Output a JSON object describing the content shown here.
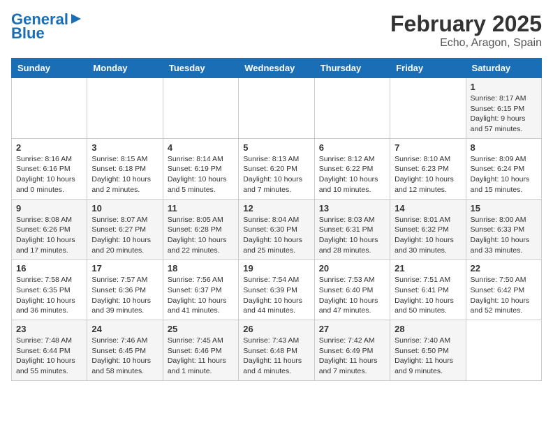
{
  "header": {
    "logo_line1": "General",
    "logo_line2": "Blue",
    "title": "February 2025",
    "subtitle": "Echo, Aragon, Spain"
  },
  "calendar": {
    "headers": [
      "Sunday",
      "Monday",
      "Tuesday",
      "Wednesday",
      "Thursday",
      "Friday",
      "Saturday"
    ],
    "weeks": [
      [
        {
          "day": "",
          "content": ""
        },
        {
          "day": "",
          "content": ""
        },
        {
          "day": "",
          "content": ""
        },
        {
          "day": "",
          "content": ""
        },
        {
          "day": "",
          "content": ""
        },
        {
          "day": "",
          "content": ""
        },
        {
          "day": "1",
          "content": "Sunrise: 8:17 AM\nSunset: 6:15 PM\nDaylight: 9 hours and 57 minutes."
        }
      ],
      [
        {
          "day": "2",
          "content": "Sunrise: 8:16 AM\nSunset: 6:16 PM\nDaylight: 10 hours and 0 minutes."
        },
        {
          "day": "3",
          "content": "Sunrise: 8:15 AM\nSunset: 6:18 PM\nDaylight: 10 hours and 2 minutes."
        },
        {
          "day": "4",
          "content": "Sunrise: 8:14 AM\nSunset: 6:19 PM\nDaylight: 10 hours and 5 minutes."
        },
        {
          "day": "5",
          "content": "Sunrise: 8:13 AM\nSunset: 6:20 PM\nDaylight: 10 hours and 7 minutes."
        },
        {
          "day": "6",
          "content": "Sunrise: 8:12 AM\nSunset: 6:22 PM\nDaylight: 10 hours and 10 minutes."
        },
        {
          "day": "7",
          "content": "Sunrise: 8:10 AM\nSunset: 6:23 PM\nDaylight: 10 hours and 12 minutes."
        },
        {
          "day": "8",
          "content": "Sunrise: 8:09 AM\nSunset: 6:24 PM\nDaylight: 10 hours and 15 minutes."
        }
      ],
      [
        {
          "day": "9",
          "content": "Sunrise: 8:08 AM\nSunset: 6:26 PM\nDaylight: 10 hours and 17 minutes."
        },
        {
          "day": "10",
          "content": "Sunrise: 8:07 AM\nSunset: 6:27 PM\nDaylight: 10 hours and 20 minutes."
        },
        {
          "day": "11",
          "content": "Sunrise: 8:05 AM\nSunset: 6:28 PM\nDaylight: 10 hours and 22 minutes."
        },
        {
          "day": "12",
          "content": "Sunrise: 8:04 AM\nSunset: 6:30 PM\nDaylight: 10 hours and 25 minutes."
        },
        {
          "day": "13",
          "content": "Sunrise: 8:03 AM\nSunset: 6:31 PM\nDaylight: 10 hours and 28 minutes."
        },
        {
          "day": "14",
          "content": "Sunrise: 8:01 AM\nSunset: 6:32 PM\nDaylight: 10 hours and 30 minutes."
        },
        {
          "day": "15",
          "content": "Sunrise: 8:00 AM\nSunset: 6:33 PM\nDaylight: 10 hours and 33 minutes."
        }
      ],
      [
        {
          "day": "16",
          "content": "Sunrise: 7:58 AM\nSunset: 6:35 PM\nDaylight: 10 hours and 36 minutes."
        },
        {
          "day": "17",
          "content": "Sunrise: 7:57 AM\nSunset: 6:36 PM\nDaylight: 10 hours and 39 minutes."
        },
        {
          "day": "18",
          "content": "Sunrise: 7:56 AM\nSunset: 6:37 PM\nDaylight: 10 hours and 41 minutes."
        },
        {
          "day": "19",
          "content": "Sunrise: 7:54 AM\nSunset: 6:39 PM\nDaylight: 10 hours and 44 minutes."
        },
        {
          "day": "20",
          "content": "Sunrise: 7:53 AM\nSunset: 6:40 PM\nDaylight: 10 hours and 47 minutes."
        },
        {
          "day": "21",
          "content": "Sunrise: 7:51 AM\nSunset: 6:41 PM\nDaylight: 10 hours and 50 minutes."
        },
        {
          "day": "22",
          "content": "Sunrise: 7:50 AM\nSunset: 6:42 PM\nDaylight: 10 hours and 52 minutes."
        }
      ],
      [
        {
          "day": "23",
          "content": "Sunrise: 7:48 AM\nSunset: 6:44 PM\nDaylight: 10 hours and 55 minutes."
        },
        {
          "day": "24",
          "content": "Sunrise: 7:46 AM\nSunset: 6:45 PM\nDaylight: 10 hours and 58 minutes."
        },
        {
          "day": "25",
          "content": "Sunrise: 7:45 AM\nSunset: 6:46 PM\nDaylight: 11 hours and 1 minute."
        },
        {
          "day": "26",
          "content": "Sunrise: 7:43 AM\nSunset: 6:48 PM\nDaylight: 11 hours and 4 minutes."
        },
        {
          "day": "27",
          "content": "Sunrise: 7:42 AM\nSunset: 6:49 PM\nDaylight: 11 hours and 7 minutes."
        },
        {
          "day": "28",
          "content": "Sunrise: 7:40 AM\nSunset: 6:50 PM\nDaylight: 11 hours and 9 minutes."
        },
        {
          "day": "",
          "content": ""
        }
      ]
    ]
  }
}
